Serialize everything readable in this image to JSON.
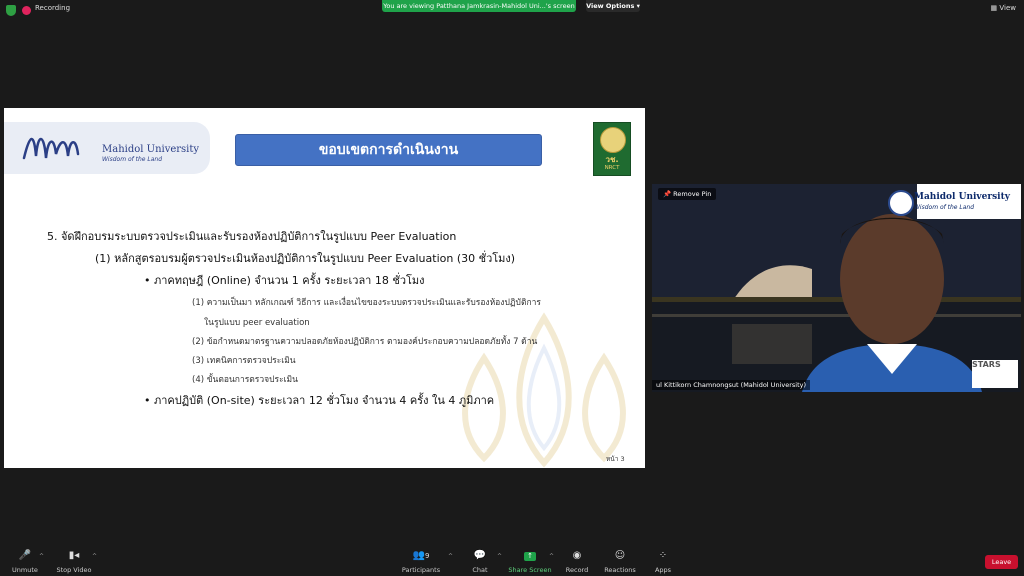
{
  "topbar": {
    "recording": "Recording",
    "viewing_banner": "You are viewing Patthana Jamkrasin-Mahidol Uni...'s screen",
    "view_options": "View Options",
    "view_button": "View"
  },
  "slide": {
    "logo_name": "Mahidol University",
    "logo_tagline": "Wisdom of the Land",
    "title": "ขอบเขตการดำเนินงาน",
    "nrct_big": "วช.",
    "nrct_small": "NRCT",
    "line1": "5. จัดฝึกอบรมระบบตรวจประเมินและรับรองห้องปฏิบัติการในรูปแบบ Peer Evaluation",
    "line2": "(1) หลักสูตรอบรมผู้ตรวจประเมินห้องปฏิบัติการในรูปแบบ Peer Evaluation (30 ชั่วโมง)",
    "bullet1": "• ภาคทฤษฎี (Online) จำนวน 1 ครั้ง ระยะเวลา 18 ชั่วโมง",
    "sub1": "(1) ความเป็นมา หลักเกณฑ์ วิธีการ และเงื่อนไขของระบบตรวจประเมินและรับรองห้องปฏิบัติการ",
    "sub1b": "ในรูปแบบ peer evaluation",
    "sub2": "(2) ข้อกำหนดมาตรฐานความปลอดภัยห้องปฏิบัติการ ตามองค์ประกอบความปลอดภัยทั้ง 7 ด้าน",
    "sub3": "(3) เทคนิคการตรวจประเมิน",
    "sub4": "(4) ขั้นตอนการตรวจประเมิน",
    "bullet2": "• ภาคปฏิบัติ (On-site) ระยะเวลา 12 ชั่วโมง จำนวน 4 ครั้ง ใน 4 ภูมิภาค",
    "page": "หน้า 3"
  },
  "video": {
    "remove_pin": "Remove Pin",
    "logo_name": "Mahidol University",
    "logo_tagline": "Wisdom of the Land",
    "stars": "STARS",
    "participant_name": "ul Kittikorn Chamnongsut (Mahidol University)"
  },
  "toolbar": {
    "unmute": "Unmute",
    "stop_video": "Stop Video",
    "participants": "Participants",
    "participant_count": "9",
    "chat": "Chat",
    "share_screen": "Share Screen",
    "record": "Record",
    "reactions": "Reactions",
    "apps": "Apps",
    "leave": "Leave"
  }
}
